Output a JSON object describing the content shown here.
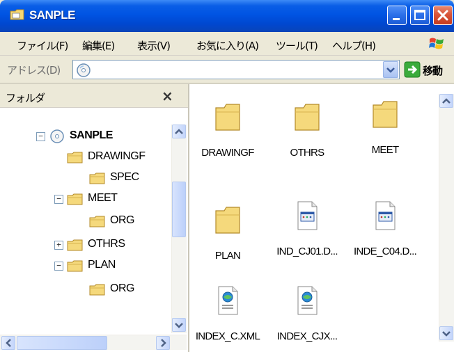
{
  "window": {
    "title": "SANPLE"
  },
  "menu": {
    "items": [
      "ファイル(F)",
      "編集(E)",
      "表示(V)",
      "お気に入り(A)",
      "ツール(T)",
      "ヘルプ(H)"
    ]
  },
  "address": {
    "label": "アドレス(D)",
    "value": "",
    "go_label": "移動"
  },
  "folder_pane": {
    "header": "フォルダ",
    "close_glyph": "×",
    "tree": [
      {
        "label": "SANPLE",
        "toggle": "−",
        "icon": "cd-drive-icon"
      },
      {
        "label": "DRAWINGF",
        "toggle": "",
        "icon": "folder-icon"
      },
      {
        "label": "SPEC",
        "toggle": "",
        "icon": "folder-icon"
      },
      {
        "label": "MEET",
        "toggle": "−",
        "icon": "folder-icon"
      },
      {
        "label": "ORG",
        "toggle": "",
        "icon": "folder-icon"
      },
      {
        "label": "OTHRS",
        "toggle": "+",
        "icon": "folder-icon"
      },
      {
        "label": "PLAN",
        "toggle": "−",
        "icon": "folder-icon"
      },
      {
        "label": "ORG",
        "toggle": "",
        "icon": "folder-icon"
      }
    ]
  },
  "files": [
    {
      "label": "DRAWINGF",
      "icon": "folder-icon"
    },
    {
      "label": "OTHRS",
      "icon": "folder-icon"
    },
    {
      "label": "MEET",
      "icon": "folder-icon"
    },
    {
      "label": "PLAN",
      "icon": "folder-icon"
    },
    {
      "label": "IND_CJ01.D...",
      "icon": "document-icon"
    },
    {
      "label": "INDE_C04.D...",
      "icon": "document-icon"
    },
    {
      "label": "INDEX_C.XML",
      "icon": "xml-file-icon"
    },
    {
      "label": "INDEX_CJX...",
      "icon": "xml-file-icon"
    }
  ],
  "colors": {
    "titlebar": "#0054e3",
    "folder_yellow": "#f5d97c",
    "close_button": "#d9553a"
  }
}
